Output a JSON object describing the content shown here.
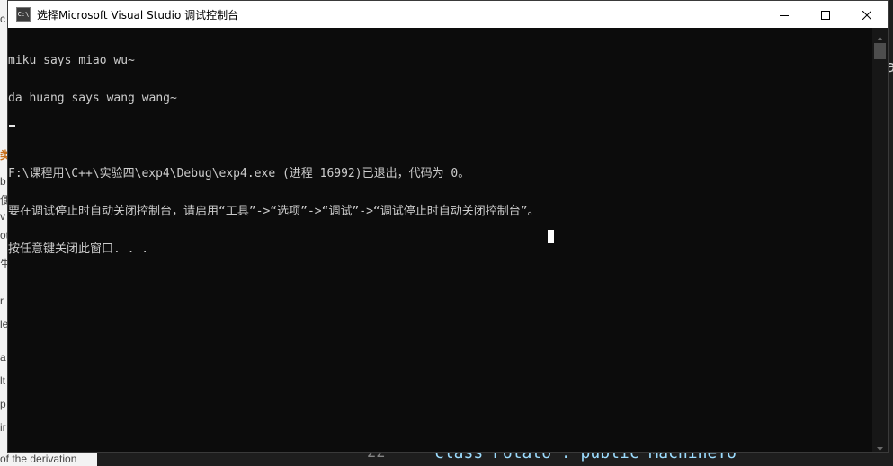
{
  "window": {
    "title": "选择Microsoft Visual Studio 调试控制台",
    "icon": "console-app-icon",
    "icon_text": "C:\\"
  },
  "controls": {
    "minimize_icon": "minimize-icon",
    "maximize_icon": "maximize-icon",
    "close_icon": "close-icon"
  },
  "console": {
    "lines": [
      "miku says miao wu~",
      "da huang says wang wang~",
      "",
      "F:\\课程用\\C++\\实验四\\exp4\\Debug\\exp4.exe (进程 16992)已退出，代码为 0。",
      "要在调试停止时自动关闭控制台，请启用“工具”->“选项”->“调试”->“调试停止时自动关闭控制台”。",
      "按任意键关闭此窗口. . ."
    ],
    "text_color": "#cccccc",
    "background_color": "#0c0c0c"
  },
  "background": {
    "left_fragments": [
      "c",
      "类",
      "b",
      "便",
      "v",
      "ot",
      "生",
      "r",
      "le",
      "a",
      "lt",
      "p",
      "ir"
    ],
    "bottom_left_text": "of the derivation",
    "right_fragments": [
      "a",
      "{"
    ],
    "code_line_number": "22",
    "code_text": "class Potato : public MachineTo"
  }
}
